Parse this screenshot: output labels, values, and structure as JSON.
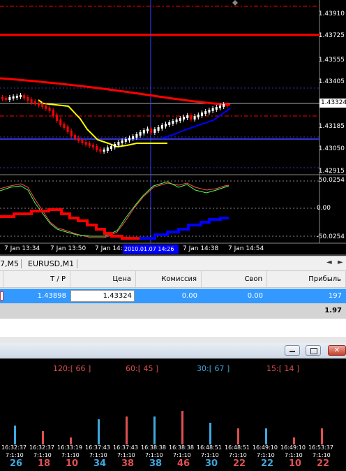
{
  "chart": {
    "price_labels": [
      "1.43910",
      "1.43725",
      "1.43555",
      "1.43405",
      "1.43324",
      "1.43185",
      "1.43050",
      "1.42915"
    ],
    "current_price": "1.43324",
    "osc_labels": [
      "50.0254",
      "0.00",
      "-50.0254"
    ],
    "time_labels": [
      "7 Jan 13:34",
      "7 Jan 13:50",
      "7 Jan 14:0",
      "7 Jan 14:38",
      "7 Jan 14:54"
    ],
    "cursor_time": "2010.01.07 14:26",
    "colors": {
      "ma": "#ff0000",
      "channel": "#0000ff",
      "trail": "#ffff00",
      "bull": "#ffffff",
      "bear": "#ff0000"
    }
  },
  "tabs": {
    "items": [
      "",
      "EURUSD,M1"
    ],
    "partial_first": "7,M5",
    "scroll_left": "◄",
    "scroll_right": "►"
  },
  "terminal": {
    "headers": [
      "T / P",
      "Цена",
      "Комиссия",
      "Своп",
      "Прибыль"
    ],
    "row": {
      "tp": "1.43898",
      "price": "1.43324",
      "commission": "0.00",
      "swap": "0.00",
      "profit": "197"
    },
    "total": "1.97"
  },
  "window": {
    "minimize": "▭",
    "restore": "❐",
    "close": "✕"
  },
  "histogram": {
    "groups": [
      {
        "label": "120:[ 66 ]",
        "color": "#e05050"
      },
      {
        "label": "60:[ 45 ]",
        "color": "#e05050"
      },
      {
        "label": "30:[ 67 ]",
        "color": "#3fa9e0"
      },
      {
        "label": "15:[ 14 ]",
        "color": "#e05050"
      }
    ],
    "bars": [
      {
        "time": "16:32:37",
        "sub": "7:1:10",
        "count": "26",
        "color": "#3fa9e0",
        "value": 26
      },
      {
        "time": "16:32:37",
        "sub": "7:1:10",
        "count": "18",
        "color": "#e05050",
        "value": 18
      },
      {
        "time": "16:33:19",
        "sub": "7:1:10",
        "count": "10",
        "color": "#e05050",
        "value": 10
      },
      {
        "time": "16:37:43",
        "sub": "7:1:10",
        "count": "34",
        "color": "#3fa9e0",
        "value": 34
      },
      {
        "time": "16:37:43",
        "sub": "7:1:10",
        "count": "38",
        "color": "#e05050",
        "value": 38
      },
      {
        "time": "16:38:38",
        "sub": "7:1:10",
        "count": "38",
        "color": "#3fa9e0",
        "value": 38
      },
      {
        "time": "16:38:38",
        "sub": "7:1:10",
        "count": "46",
        "color": "#e05050",
        "value": 46
      },
      {
        "time": "16:48:51",
        "sub": "7:1:10",
        "count": "30",
        "color": "#3fa9e0",
        "value": 30
      },
      {
        "time": "16:48:51",
        "sub": "7:1:10",
        "count": "22",
        "color": "#e05050",
        "value": 22
      },
      {
        "time": "16:49:10",
        "sub": "7:1:10",
        "count": "22",
        "color": "#3fa9e0",
        "value": 22
      },
      {
        "time": "16:49:10",
        "sub": "7:1:10",
        "count": "10",
        "color": "#e05050",
        "value": 10
      },
      {
        "time": "16:53:37",
        "sub": "7:1:10",
        "count": "22",
        "color": "#e05050",
        "value": 22
      }
    ]
  }
}
